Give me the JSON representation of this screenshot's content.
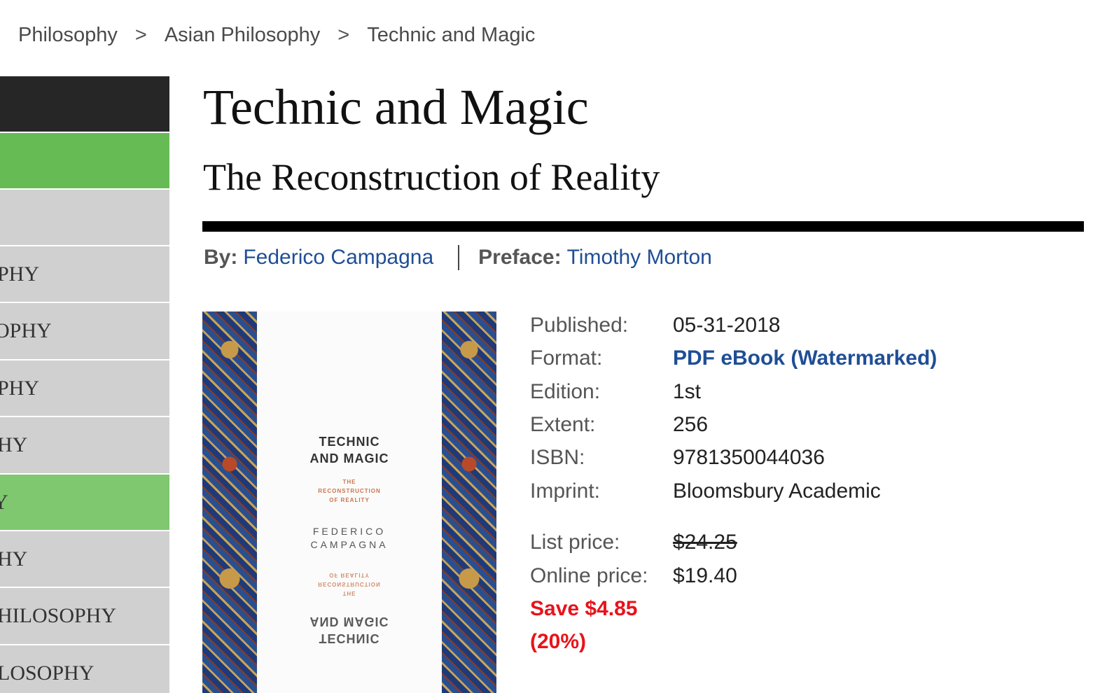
{
  "breadcrumb": {
    "items": [
      "Philosophy",
      "Asian Philosophy",
      "Technic and Magic"
    ],
    "separator": ">"
  },
  "sidebar": {
    "items": [
      {
        "label": "",
        "style": "dark"
      },
      {
        "label": "",
        "style": "green"
      },
      {
        "label": "",
        "style": "gray"
      },
      {
        "label": "PHY",
        "style": "gray"
      },
      {
        "label": "OPHY",
        "style": "gray"
      },
      {
        "label": "PHY",
        "style": "gray"
      },
      {
        "label": "HY",
        "style": "gray"
      },
      {
        "label": "Y",
        "style": "light-green"
      },
      {
        "label": "HY",
        "style": "gray"
      },
      {
        "label": "HILOSOPHY",
        "style": "gray"
      },
      {
        "label": "LOSOPHY",
        "style": "gray"
      }
    ]
  },
  "book": {
    "title": "Technic and Magic",
    "subtitle": "The Reconstruction of Reality",
    "by_label": "By:",
    "author": "Federico Campagna",
    "preface_label": "Preface:",
    "preface_author": "Timothy Morton"
  },
  "cover": {
    "line1": "TECHNIC",
    "line2": "AND MAGIC",
    "sub1": "THE",
    "sub2": "RECONSTRUCTION",
    "sub3": "OF REALITY",
    "author1": "FEDERICO",
    "author2": "CAMPAGNA"
  },
  "details": {
    "published_label": "Published:",
    "published": "05-31-2018",
    "format_label": "Format:",
    "format": "PDF eBook (Watermarked)",
    "edition_label": "Edition:",
    "edition": "1st",
    "extent_label": "Extent:",
    "extent": "256",
    "isbn_label": "ISBN:",
    "isbn": "9781350044036",
    "imprint_label": "Imprint:",
    "imprint": "Bloomsbury Academic",
    "list_price_label": "List price:",
    "list_price": "$24.25",
    "online_price_label": "Online price:",
    "online_price": "$19.40",
    "save_line1": "Save $4.85",
    "save_line2": "(20%)"
  },
  "colors": {
    "link": "#1f4e96",
    "save": "#e8131a",
    "sidebar_dark": "#262626",
    "sidebar_green": "#66bb55",
    "sidebar_gray": "#d0d0d0"
  }
}
